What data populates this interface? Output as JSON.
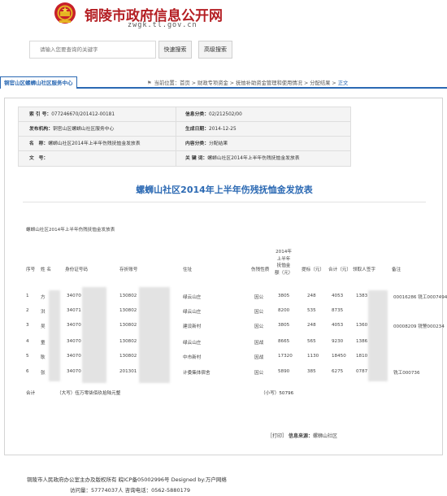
{
  "header": {
    "title": "铜陵市政府信息公开网",
    "domain": "zwgk.tl.gov.cn",
    "emblem_icon": "national-emblem-icon"
  },
  "search": {
    "placeholder": "请输入您要查询的关键字",
    "quick_label": "快速搜索",
    "advanced_label": "高级搜索"
  },
  "nav": {
    "tab_label": "铜官山区螺蛳山社区服务中心",
    "crumb_prefix": "当前位置：",
    "crumbs": [
      "首页",
      "财政专项资金",
      "抚恤补助资金管理和使用情况",
      "分配结果"
    ],
    "current": "正文",
    "separator": " > "
  },
  "info": {
    "index_label": "索 引 号：",
    "index_value": "077246670/201412-00181",
    "category_label": "信息分类：",
    "category_value": "02/212502/00",
    "org_label": "发布机构：",
    "org_value": "铜官山区螺蛳山社区服务中心",
    "date_label": "生成日期：",
    "date_value": "2014-12-25",
    "name_label": "名　称：",
    "name_value": "螺蛳山社区2014年上半年伤残抚恤金发放表",
    "content_label": "内容分类：",
    "content_value": "分配结果",
    "docno_label": "文　号：",
    "docno_value": "",
    "keywords_label": "关 键 词：",
    "keywords_value": "螺蛳山社区2014年上半年伤残抚恤金发放表"
  },
  "document": {
    "title": "螺蛳山社区2014年上半年伤残抚恤金发放表",
    "subtitle": "螺蛳山社区2014年上半年伤残抚恤金发放表"
  },
  "table": {
    "headers": {
      "seq": "序号",
      "name": "姓 名",
      "id_no": "身份证号码",
      "passbook": "存折账号",
      "address": "住址",
      "disability": "伤残性质",
      "amount": "2014年上半年抚恤金额（元）",
      "raise": "提标（元）",
      "total": "合计（元）",
      "signature": "领取人签字",
      "remark": "备注"
    },
    "rows": [
      {
        "seq": "1",
        "name": "方",
        "id": "34070",
        "passbook": "130802",
        "address": "绿云山庄",
        "type": "因公",
        "amount": "3805",
        "raise": "248",
        "total": "4053",
        "sig": "1383",
        "remark": "00016286 铣工0007494"
      },
      {
        "seq": "2",
        "name": "洪",
        "id": "34071",
        "passbook": "130802",
        "address": "绿云山庄",
        "type": "因公",
        "amount": "8200",
        "raise": "535",
        "total": "8735",
        "sig": "",
        "remark": ""
      },
      {
        "seq": "3",
        "name": "吴",
        "id": "34070",
        "passbook": "130802",
        "address": "建设新村",
        "type": "因公",
        "amount": "3805",
        "raise": "248",
        "total": "4053",
        "sig": "1360",
        "remark": "00008209 铣警000234"
      },
      {
        "seq": "4",
        "name": "童",
        "id": "34070",
        "passbook": "130802",
        "address": "绿云山庄",
        "type": "因战",
        "amount": "8665",
        "raise": "565",
        "total": "9230",
        "sig": "1386",
        "remark": ""
      },
      {
        "seq": "5",
        "name": "耿",
        "id": "34070",
        "passbook": "130802",
        "address": "中市新村",
        "type": "因战",
        "amount": "17320",
        "raise": "1130",
        "total": "18450",
        "sig": "1810",
        "remark": ""
      },
      {
        "seq": "6",
        "name": "张",
        "id": "34070",
        "passbook": "201301",
        "address": "计委集体宿舍",
        "type": "因公",
        "amount": "5890",
        "raise": "385",
        "total": "6275",
        "sig": "0787",
        "remark": "铣工000736"
      }
    ],
    "total_label": "合计",
    "total_words": "（大写）伍万零柒佰玖拾陆元整",
    "total_number": "（小写）50796"
  },
  "actions": {
    "print_label": "［打印］",
    "source_label": "信息来源：",
    "source_value": "螺蛳山社区"
  },
  "footer": {
    "line1": "铜陵市人民政府办公室主办及版权所有 皖ICP备05002996号 Designed by:万户网络",
    "line2": "访问量：57774037人 咨询电话：0562-5880179"
  }
}
